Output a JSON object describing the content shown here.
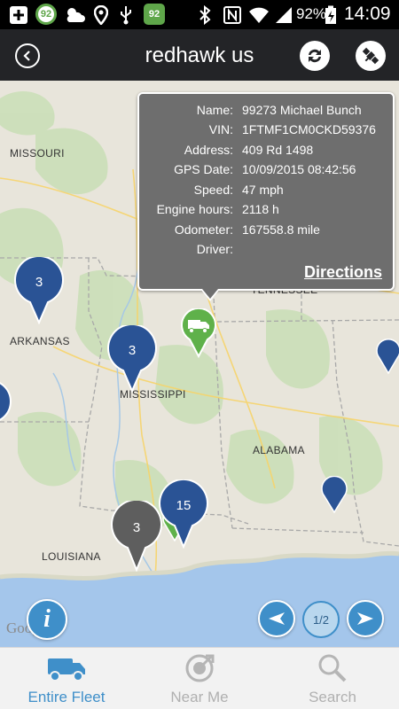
{
  "status_bar": {
    "badge1": "92",
    "badge2": "92",
    "battery_percent": "92%",
    "time": "14:09"
  },
  "app_bar": {
    "title": "redhawk us",
    "back_icon": "back-icon",
    "refresh_icon": "refresh-icon",
    "satellite_icon": "satellite-icon"
  },
  "map": {
    "labels": {
      "missouri": "MISSOURI",
      "arkansas": "ARKANSAS",
      "mississippi": "MISSISSIPPI",
      "alabama": "ALABAMA",
      "louisiana": "LOUISIANA",
      "tennessee": "TENNESSEE"
    },
    "clusters": {
      "arkansas_count": "3",
      "mississippi_count": "3",
      "south_count": "15",
      "grey_count": "3"
    },
    "attribution": "Google"
  },
  "popup": {
    "rows": [
      {
        "label": "Name:",
        "value": "99273 Michael Bunch"
      },
      {
        "label": "VIN:",
        "value": "1FTMF1CM0CKD59376"
      },
      {
        "label": "Address:",
        "value": "409 Rd 1498"
      },
      {
        "label": "GPS Date:",
        "value": "10/09/2015 08:42:56"
      },
      {
        "label": "Speed:",
        "value": "47 mph"
      },
      {
        "label": "Engine hours:",
        "value": "2118 h"
      },
      {
        "label": "Odometer:",
        "value": "167558.8 mile"
      },
      {
        "label": "Driver:",
        "value": ""
      }
    ],
    "directions": "Directions"
  },
  "pager": {
    "page": "1/2"
  },
  "tabs": [
    {
      "label": "Entire Fleet",
      "active": true
    },
    {
      "label": "Near Me",
      "active": false
    },
    {
      "label": "Search",
      "active": false
    }
  ],
  "colors": {
    "accent": "#3f8fc9",
    "marker_blue": "#2a5395",
    "marker_grey": "#5e5e5e",
    "vehicle_green": "#5fb14a"
  }
}
